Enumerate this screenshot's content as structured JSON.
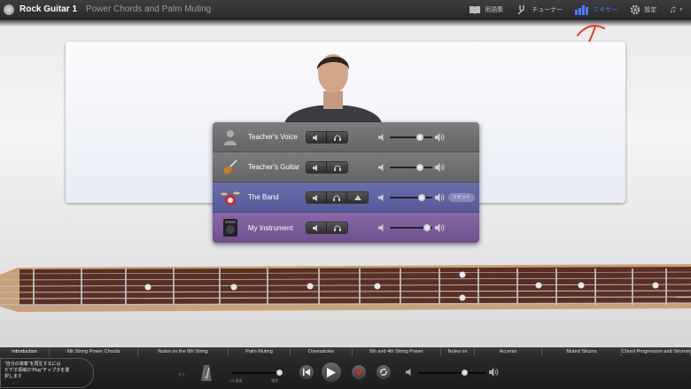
{
  "topbar": {
    "app_title": "Rock Guitar 1",
    "lesson_title": "Power Chords and Palm Muting",
    "buttons": [
      {
        "label": "用語集",
        "icon": "book-icon"
      },
      {
        "label": "チューナー",
        "icon": "tuning-fork-icon"
      },
      {
        "label": "ミキサー",
        "icon": "mixer-bars-icon",
        "active": true
      },
      {
        "label": "設定",
        "icon": "gear-icon"
      },
      {
        "label": "",
        "icon": "music-note-icon"
      }
    ]
  },
  "mixer": {
    "tracks": [
      {
        "name": "Teacher's Voice",
        "icon": "teacher-voice-icon",
        "volume": 0.7,
        "style": "gray"
      },
      {
        "name": "Teacher's Guitar",
        "icon": "guitar-icon",
        "volume": 0.7,
        "style": "gray"
      },
      {
        "name": "The Band",
        "icon": "drum-kit-icon",
        "volume": 0.75,
        "style": "band",
        "reset_label": "リセット"
      },
      {
        "name": "My Instrument",
        "icon": "amplifier-icon",
        "volume": 0.88,
        "style": "mine"
      }
    ]
  },
  "chapters": [
    "Introduction",
    "6th String Power Chords",
    "Notes on the 6th String",
    "Palm Muting",
    "Downstroke",
    "5th and 4th String Power",
    "Notes on",
    "Accents",
    "Muted Strums",
    "Chord Progression and Strumming Pattern"
  ],
  "hint": {
    "lines": [
      "\"自分の演奏\"を再生するには",
      "ビデオ領域の\"Play\"チャプタを選",
      "択します"
    ]
  },
  "transport": {
    "tempo_label": "大人",
    "count_in_label": "1/2",
    "speed_label_left": "1/2 速度",
    "speed_label_right": "通常",
    "speed_value": 1.0,
    "master_volume": 0.7
  },
  "colors": {
    "accent": "#4a7cff",
    "annotation": "#e8391f",
    "band_track": "#5f63a3",
    "my_instrument_track": "#7b5b99"
  }
}
